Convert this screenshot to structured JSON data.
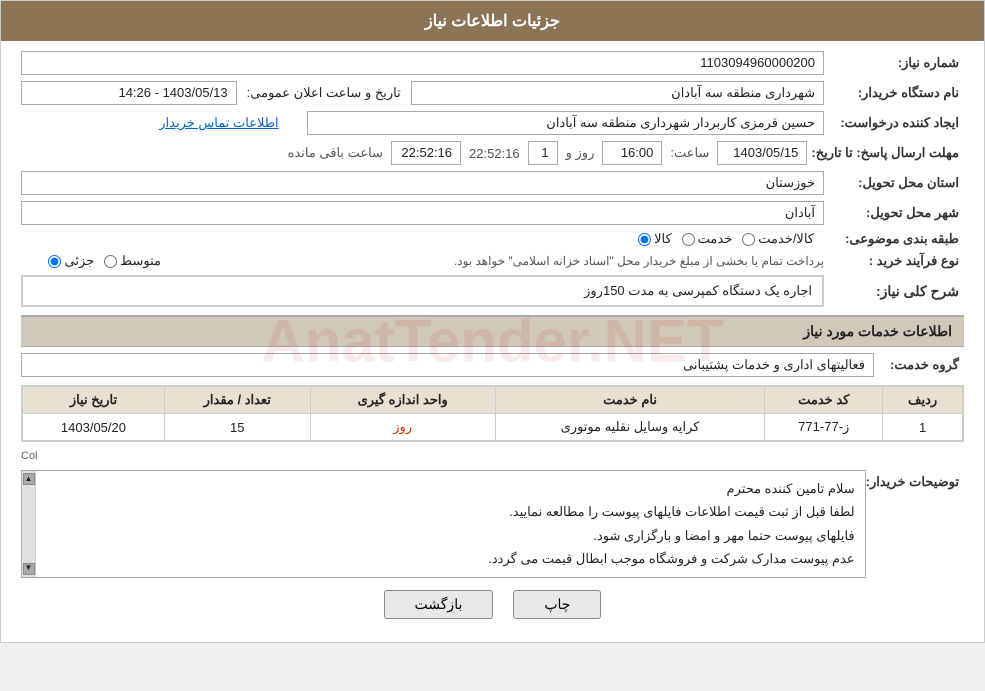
{
  "page": {
    "title": "جزئیات اطلاعات نیاز"
  },
  "fields": {
    "need_number_label": "شماره نیاز:",
    "need_number_value": "1103094960000200",
    "buyer_org_label": "نام دستگاه خریدار:",
    "buyer_org_value": "شهرداری منطقه سه آبادان",
    "datetime_label": "تاریخ و ساعت اعلان عمومی:",
    "datetime_value": "1403/05/13 - 14:26",
    "creator_label": "ایجاد کننده درخواست:",
    "creator_value": "حسین قرمزی کاربردار شهرداری منطقه سه آبادان",
    "contact_link": "اطلاعات تماس خریدار",
    "deadline_label": "مهلت ارسال پاسخ: تا تاریخ:",
    "deadline_date": "1403/05/15",
    "deadline_time_label": "ساعت:",
    "deadline_time": "16:00",
    "deadline_day_label": "روز و",
    "deadline_remaining": "1",
    "deadline_remaining_time": "22:52:16",
    "deadline_remaining_label": "ساعت باقی مانده",
    "province_label": "استان محل تحویل:",
    "province_value": "خوزستان",
    "city_label": "شهر محل تحویل:",
    "city_value": "آبادان",
    "category_label": "طبقه بندی موضوعی:",
    "radio_kala": "کالا",
    "radio_khedmat": "خدمت",
    "radio_kala_khedmat": "کالا/خدمت",
    "proc_type_label": "نوع فرآیند خرید :",
    "radio_jozvi": "جزئی",
    "radio_motavaset": "متوسط",
    "proc_note": "پرداخت تمام یا بخشی از مبلغ خریدار محل \"اسناد خزانه اسلامی\" خواهد بود.",
    "need_desc_label": "شرح کلی نیاز:",
    "need_desc_value": "اجاره یک دستگاه کمپرسی به مدت 150روز",
    "services_section_title": "اطلاعات خدمات مورد نیاز",
    "service_group_label": "گروه خدمت:",
    "service_group_value": "فعالیتهای اداری و خدمات پشتیبانی",
    "table": {
      "headers": [
        "ردیف",
        "کد خدمت",
        "نام خدمت",
        "واحد اندازه گیری",
        "تعداد / مقدار",
        "تاریخ نیاز"
      ],
      "rows": [
        {
          "row_num": "1",
          "service_code": "ز-77-771",
          "service_name": "کرایه وسایل نقلیه موتوری",
          "unit": "روز",
          "qty": "15",
          "date": "1403/05/20"
        }
      ]
    },
    "col_label": "Col",
    "buyer_notes_label": "توضیحات خریدار:",
    "buyer_notes_lines": [
      "سلام تامین کننده محترم",
      "لطفا قبل از ثبت قیمت اطلاعات فایلهای پیوست را مطالعه نمایید.",
      "فایلهای پیوست حتما مهر و امضا و بارگزاری شود.",
      "عدم پیوست مدارک شرکت و فروشگاه موجب ابطال قیمت می گردد."
    ],
    "btn_back": "بازگشت",
    "btn_print": "چاپ"
  },
  "colors": {
    "header_bg": "#8B7355",
    "section_bg": "#d0c8b8",
    "link_color": "#0066cc",
    "unit_color": "#cc3300"
  }
}
